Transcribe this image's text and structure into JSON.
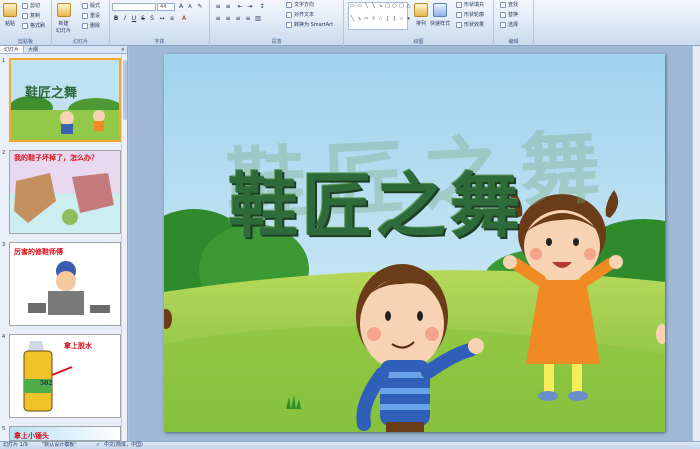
{
  "ribbon": {
    "clipboard": {
      "paste_label": "粘贴",
      "cut_label": "剪切",
      "copy_label": "复制",
      "format_painter_label": "格式刷",
      "group_label": "剪贴板"
    },
    "slides": {
      "new_slide_label": "新建\n幻灯片",
      "layout_label": "版式",
      "reset_label": "重设",
      "delete_label": "删除",
      "group_label": "幻灯片"
    },
    "font": {
      "font_name": "",
      "font_size": "44",
      "group_label": "字体"
    },
    "paragraph": {
      "text_direction_label": "文字方向",
      "align_text_label": "对齐文本",
      "smartart_label": "转换为 SmartArt",
      "group_label": "段落"
    },
    "drawing": {
      "arrange_label": "排列",
      "quick_styles_label": "快速样式",
      "shape_fill_label": "形状填充",
      "shape_outline_label": "形状轮廓",
      "shape_effects_label": "形状效果",
      "group_label": "绘图"
    },
    "editing": {
      "find_label": "查找",
      "replace_label": "替换",
      "select_label": "选择",
      "group_label": "编辑"
    }
  },
  "left_pane": {
    "tabs": [
      "幻灯片",
      "大纲"
    ],
    "close_glyph": "×",
    "slides": [
      {
        "number": "1",
        "caption": "鞋匠之舞",
        "selected": true
      },
      {
        "number": "2",
        "caption": "我的鞋子坏掉了，怎么办？",
        "selected": false
      },
      {
        "number": "3",
        "caption": "厉害的修鞋师傅",
        "selected": false
      },
      {
        "number": "4",
        "caption": "拿上胶水",
        "label_502": "502",
        "selected": false
      },
      {
        "number": "5",
        "caption": "拿上小锤头",
        "selected": false
      }
    ]
  },
  "slide": {
    "title": "鞋匠之舞",
    "shadow_title": "鞋匠之舞",
    "colors": {
      "sky": "#bfe2f3",
      "grass": "#8ac43c",
      "title": "#2f6b3a"
    }
  },
  "status_bar": {
    "slide_counter": "幻灯片 1/9",
    "theme": "\"默认设计模板\"",
    "language": "中文(简体，中国)"
  }
}
